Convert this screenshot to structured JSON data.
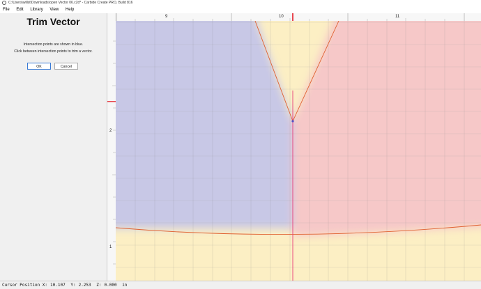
{
  "window": {
    "title": "C:\\Users\\willst\\Downloads\\open Vector 06.c2d* - Carbide Create PRO, Build 816"
  },
  "menu": [
    "File",
    "Edit",
    "Library",
    "View",
    "Help"
  ],
  "panel": {
    "title": "Trim Vector",
    "line1": "Intersection points are shown in blue.",
    "line2": "Click between intersection points to trim a vector.",
    "ok_label": "OK",
    "cancel_label": "Cancel"
  },
  "ruler": {
    "x_labels": [
      "9",
      "10",
      "11"
    ],
    "y_labels": [
      "2",
      "1"
    ]
  },
  "status": {
    "x_label": "Cursor Position X:",
    "x": "10.107",
    "y_label": "Y:",
    "y": "2.253",
    "z_label": "Z:",
    "z": "0.000",
    "unit": "in"
  },
  "colors": {
    "blue_region": "#c8c8e6",
    "red_region": "#f6c8c8",
    "yellow_region": "#fcefc4",
    "vector_line": "#e06030",
    "cursor_line": "#e83c7a"
  }
}
